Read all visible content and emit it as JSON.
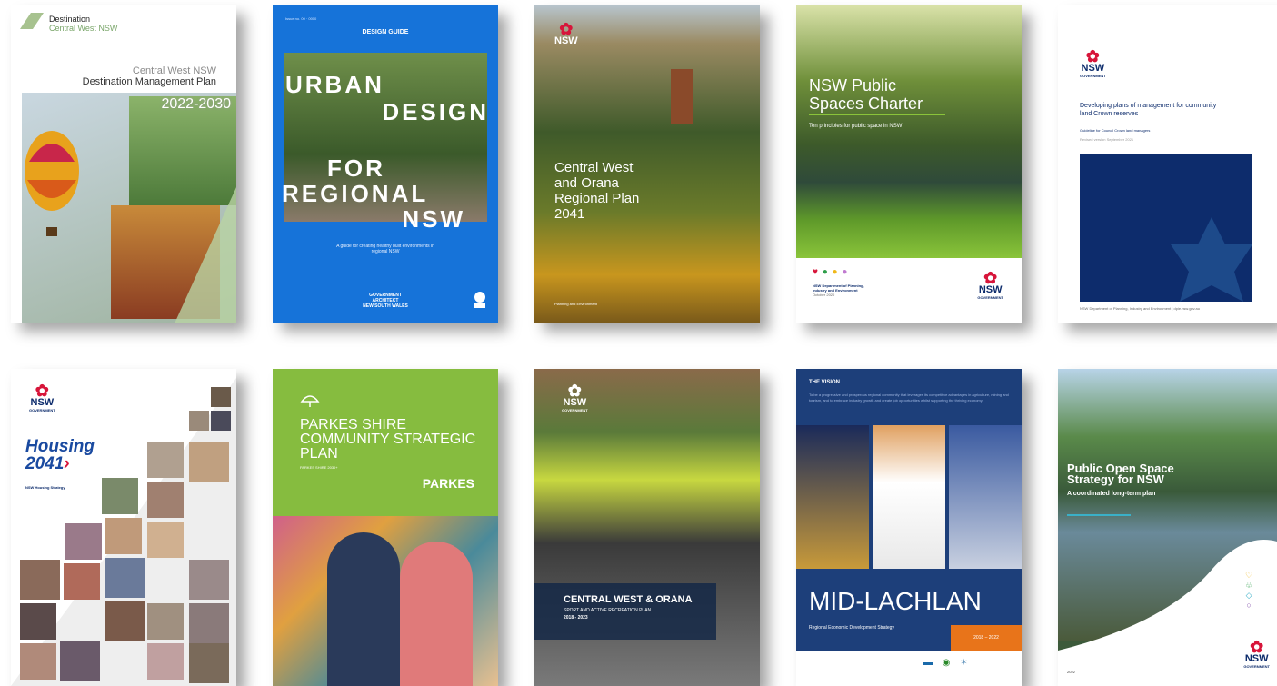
{
  "covers": {
    "c1": {
      "brand": "Destination",
      "brand_sub": "Central West NSW",
      "line1": "Central West NSW",
      "line2": "Destination Management Plan",
      "years": "2022-2030"
    },
    "c2": {
      "top_small": "Issue no. 00 · 0000",
      "label": "DESIGN GUIDE",
      "title": [
        "URBAN",
        "DESIGN",
        "FOR",
        "REGIONAL",
        "NSW"
      ],
      "sub": "A guide for creating healthy built environments in regional NSW",
      "foot1": "GOVERNMENT",
      "foot2": "ARCHITECT",
      "foot3": "NEW SOUTH WALES"
    },
    "c3": {
      "logo": "NSW",
      "title": [
        "Central West",
        "and Orana",
        "Regional Plan",
        "2041"
      ],
      "foot": "Planning and Environment"
    },
    "c4": {
      "title1": "NSW Public",
      "title2": "Spaces Charter",
      "sub": "Ten principles for public space in NSW",
      "dept1": "NSW Department of Planning,",
      "dept2": "Industry and Environment",
      "date": "October 2020",
      "logo": "NSW",
      "logo_sub": "GOVERNMENT"
    },
    "c5": {
      "logo": "NSW",
      "logo_sub": "GOVERNMENT",
      "title1": "Developing plans of management for community",
      "title2": "land Crown reserves",
      "sub": "Guideline for Council Crown land managers",
      "rev": "Revised version September 2021",
      "foot": "NSW Department of Planning, Industry and Environment | dpie.nsw.gov.au"
    },
    "c6": {
      "logo": "NSW",
      "logo_sub": "GOVERNMENT",
      "title1": "Housing",
      "title2": "2041",
      "sub": "NSW Housing Strategy"
    },
    "c7": {
      "title1": "PARKES SHIRE",
      "title2": "COMMUNITY STRATEGIC",
      "title3": "PLAN",
      "small": "PARKES SHIRE 2030+",
      "brand": "PARKES"
    },
    "c8": {
      "logo": "NSW",
      "logo_sub": "GOVERNMENT",
      "title": "CENTRAL WEST & ORANA",
      "sub": "SPORT AND ACTIVE RECREATION PLAN",
      "years": "2018 - 2023"
    },
    "c9": {
      "label": "THE VISION",
      "vision": "To be a progressive and prosperous regional community that leverages its competitive advantages in agriculture, mining and tourism, and to embrace industry growth and create job opportunities whilst supporting the thriving economy.",
      "title": "MID-LACHLAN",
      "sub": "Regional Economic Development Strategy",
      "years": "2018 – 2022"
    },
    "c10": {
      "title1": "Public Open Space",
      "title2": "Strategy for NSW",
      "sub": "A coordinated long-term plan",
      "year": "2022",
      "logo": "NSW",
      "logo_sub": "GOVERNMENT"
    }
  },
  "colors": {
    "nsw_red": "#d7153a",
    "nsw_navy": "#0d2c6c",
    "guide_blue": "#1673d9",
    "parkes_green": "#86bc3f"
  }
}
